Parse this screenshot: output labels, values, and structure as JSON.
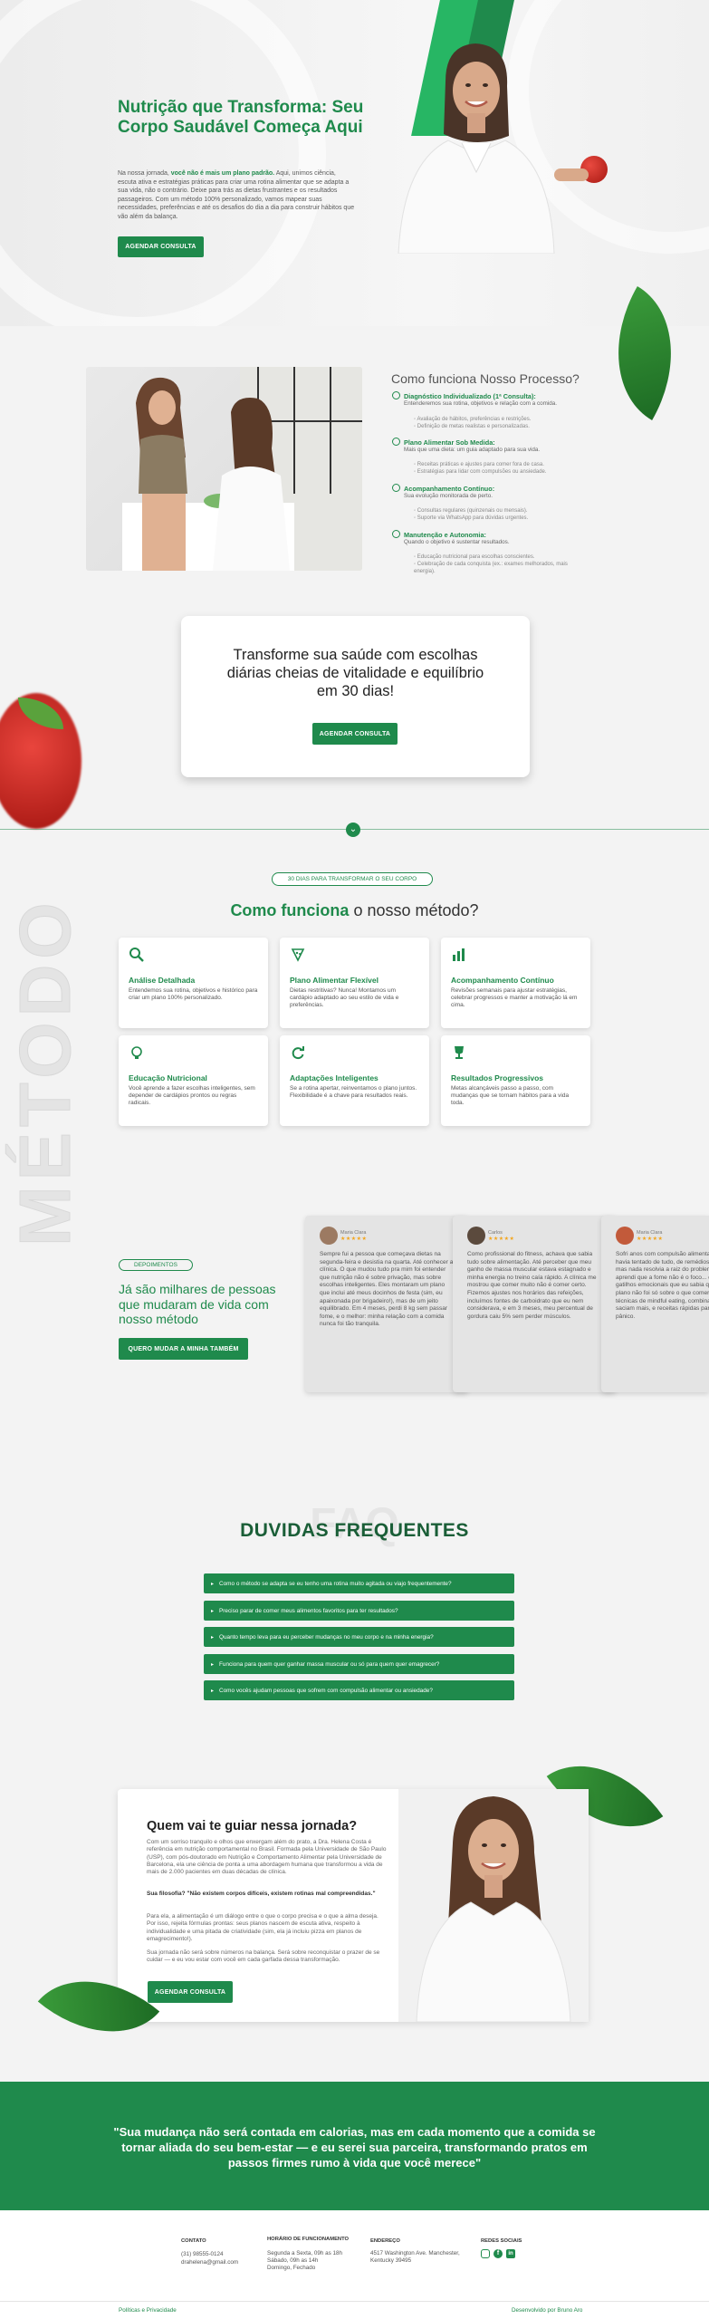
{
  "hero": {
    "title": "Nutrição que Transforma: Seu Corpo Saudável Começa Aqui",
    "text_a": "Na nossa jornada, ",
    "text_b": "você não é mais um plano padrão.",
    "text_c": " Aqui, unimos ciência, escuta ativa e estratégias práticas para criar uma rotina alimentar que se adapta a sua vida, não o contrário. Deixe para trás as dietas frustrantes e os resultados passageiros. Com um método 100% personalizado, vamos mapear suas necessidades, preferências e até os desafios do dia a dia para construir hábitos que vão além da balança.",
    "button": "AGENDAR CONSULTA"
  },
  "process": {
    "title": "Como funciona Nosso Processo?",
    "steps": [
      {
        "title": "Diagnóstico Individualizado (1ª Consulta):",
        "subtitle": "Entenderemos sua rotina, objetivos e relação com a comida.",
        "bullets": [
          "Avaliação de hábitos, preferências e restrições.",
          "Definição de metas realistas e personalizadas."
        ]
      },
      {
        "title": "Plano Alimentar Sob Medida:",
        "subtitle": "Mais que uma dieta: um guia adaptado para sua vida.",
        "bullets": [
          "Receitas práticas e ajustes para comer fora de casa.",
          "Estratégias para lidar com compulsões ou ansiedade."
        ]
      },
      {
        "title": "Acompanhamento Contínuo:",
        "subtitle": "Sua evolução monitorada de perto.",
        "bullets": [
          "Consultas regulares (quinzenais ou mensais).",
          "Suporte via WhatsApp para dúvidas urgentes."
        ]
      },
      {
        "title": "Manutenção e Autonomia:",
        "subtitle": "Quando o objetivo é sustentar resultados.",
        "bullets": [
          "Educação nutricional para escolhas conscientes.",
          "Celebração de cada conquista (ex.: exames melhorados, mais energia)."
        ]
      }
    ]
  },
  "cta": {
    "text": "Transforme sua saúde com escolhas diárias cheias de vitalidade e equilíbrio em 30 dias!",
    "button": "AGENDAR CONSULTA"
  },
  "method": {
    "pill": "30 DIAS PARA TRANSFORMAR O SEU CORPO",
    "title_a": "Como funciona",
    "title_b": " o nosso método?",
    "ghost": "MÉTODO",
    "cards": [
      {
        "icon": "search-icon",
        "title": "Análise Detalhada",
        "desc": "Entendemos sua rotina, objetivos e histórico para criar um plano 100% personalizado."
      },
      {
        "icon": "food-plate-icon",
        "title": "Plano Alimentar Flexível",
        "desc": "Dietas restritivas? Nunca! Montamos um cardápio adaptado ao seu estilo de vida e preferências."
      },
      {
        "icon": "bar-chart-icon",
        "title": "Acompanhamento Contínuo",
        "desc": "Revisões semanais para ajustar estratégias, celebrar progressos e manter a motivação lá em cima."
      },
      {
        "icon": "lightbulb-icon",
        "title": "Educação Nutricional",
        "desc": "Você aprende a fazer escolhas inteligentes, sem depender de cardápios prontos ou regras radicais."
      },
      {
        "icon": "refresh-icon",
        "title": "Adaptações Inteligentes",
        "desc": "Se a rotina apertar, reinventamos o plano juntos. Flexibilidade é a chave para resultados reais."
      },
      {
        "icon": "trophy-icon",
        "title": "Resultados Progressivos",
        "desc": "Metas alcançáveis passo a passo, com mudanças que se tornam hábitos para a vida toda."
      }
    ]
  },
  "testimonials": {
    "pill": "DEPOIMENTOS",
    "title": "Já são milhares de pessoas que mudaram de vida com nosso método",
    "button": "QUERO MUDAR A MINHA TAMBÉM",
    "items": [
      {
        "name": "Maria Clara",
        "stars": "★★★★★",
        "text": "Sempre fui a pessoa que começava dietas na segunda-feira e desistia na quarta. Até conhecer a clínica. O que mudou tudo pra mim foi entender que nutrição não é sobre privação, mas sobre escolhas inteligentes. Eles montaram um plano que inclui até meus docinhos de festa (sim, eu apaixonada por brigadeiro!), mas de um jeito equilibrado. Em 4 meses, perdi 8 kg sem passar fome, e o melhor: minha relação com a comida nunca foi tão tranquila."
      },
      {
        "name": "Carlos",
        "stars": "★★★★★",
        "text": "Como profissional do fitness, achava que sabia tudo sobre alimentação. Até perceber que meu ganho de massa muscular estava estagnado e minha energia no treino caía rápido. A clínica me mostrou que comer muito não é comer certo. Fizemos ajustes nos horários das refeições, incluímos fontes de carboidrato que eu nem considerava, e em 3 meses, meu percentual de gordura caiu 5% sem perder músculos."
      },
      {
        "name": "Maria Clara",
        "stars": "★★★★★",
        "text": "Sofri anos com compulsão alimentar e culpa. Já havia tentado de tudo, de remédios controlados, mas nada resolvia a raiz do problema. Aqui, aprendi que a fome não é o foco... descobri gatilhos emocionais que eu sabia que existiam. O plano não foi só sobre o que comer, mas como: técnicas de mindful eating, combinações que saciam mais, e receitas rápidas para dias de pânico."
      }
    ]
  },
  "faq": {
    "title": "DUVIDAS FREQUENTES",
    "ghost": "FAQ",
    "items": [
      "Como o método se adapta se eu tenho uma rotina muito agitada ou viajo frequentemente?",
      "Preciso parar de comer meus alimentos favoritos para ter resultados?",
      "Quanto tempo leva para eu perceber mudanças no meu corpo e na minha energia?",
      "Funciona para quem quer ganhar massa muscular ou só para quem quer emagrecer?",
      "Como vocês ajudam pessoas que sofrem com compulsão alimentar ou ansiedade?"
    ]
  },
  "guide": {
    "title": "Quem vai te guiar nessa jornada?",
    "p1": "Com um sorriso tranquilo e olhos que enxergam além do prato, a Dra. Helena Costa é referência em nutrição comportamental no Brasil. Formada pela Universidade de São Paulo (USP), com pós-doutorado em Nutrição e Comportamento Alimentar pela Universidade de Barcelona, ela une ciência de ponta a uma abordagem humana que transformou a vida de mais de 2.000 pacientes em duas décadas de clínica.",
    "p2": "Sua filosofia? \"Não existem corpos difíceis, existem rotinas mal compreendidas.\"",
    "p3": "Para ela, a alimentação é um diálogo entre o que o corpo precisa e o que a alma deseja. Por isso, rejeita fórmulas prontas: seus planos nascem de escuta ativa, respeito à individualidade e uma pitada de criatividade (sim, ela já incluiu pizza em planos de emagrecimento!).",
    "p4": "Sua jornada não será sobre números na balança. Será sobre reconquistar o prazer de se cuidar — e eu vou estar com você em cada garfada dessa transformação.",
    "button": "AGENDAR CONSULTA"
  },
  "quote": {
    "text": "\"Sua mudança não será contada em calorias, mas em cada momento que a comida se tornar aliada do seu bem-estar — e eu serei sua parceira, transformando pratos em passos firmes rumo à vida que você merece\""
  },
  "footer": {
    "contact_h": "CONTATO",
    "phone": "(31) 98555-0124",
    "email": "drahelena@gmail.com",
    "hours_h": "HORÁRIO DE FUNCIONAMENTO",
    "hours": [
      "Segunda a Sexta, 09h as 18h",
      "Sábado, 09h as 14h",
      "Domingo, Fechado"
    ],
    "address_h": "ENDEREÇO",
    "address": [
      "4517 Washington Ave. Manchester,",
      "Kentucky 39495"
    ],
    "social_h": "REDES SOCIAIS",
    "privacy": "Políticas e Privacidade",
    "credit": "Desenvolvido por Bruno Aro"
  },
  "colors": {
    "primary": "#1f8a4c",
    "primary_light": "#27b664",
    "dark_green": "#1a5e37"
  }
}
